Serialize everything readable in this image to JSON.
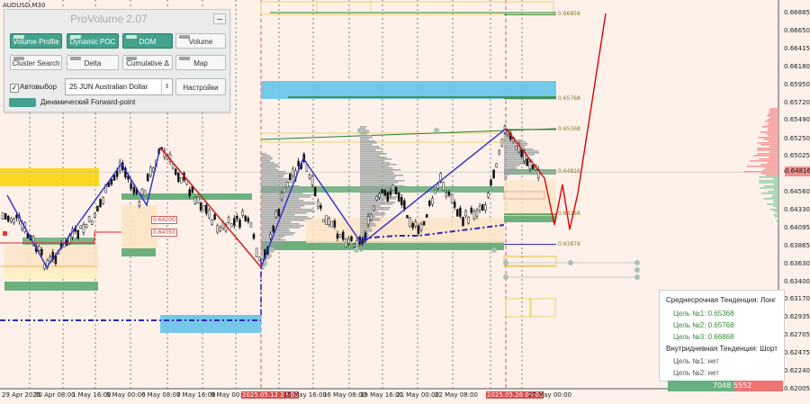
{
  "chart_symbol": "AUDUSD,M30",
  "panel": {
    "title": "ProVolume 2.07",
    "buttons": [
      {
        "label": "Volume Profile",
        "active": true
      },
      {
        "label": "Dynamic POC",
        "active": true
      },
      {
        "label": "DOM",
        "active": true
      },
      {
        "label": "Volume",
        "active": false
      },
      {
        "label": "Cluster Search",
        "active": false
      },
      {
        "label": "Delta",
        "active": false
      },
      {
        "label": "Cumulative Δ",
        "active": false
      },
      {
        "label": "Map",
        "active": false
      }
    ],
    "auto_select_label": "Автовыбор",
    "auto_select_checked": true,
    "instrument": "25 JUN Australian Dollar",
    "settings_label": "Настройки",
    "forward_point_label": "Динамический Forward-point"
  },
  "price_axis": [
    "0.66885",
    "0.66650",
    "0.66415",
    "0.66180",
    "0.65950",
    "0.65720",
    "0.65490",
    "0.65250",
    "0.65025",
    "0.64816",
    "0.64560",
    "0.64330",
    "0.64095",
    "0.63865",
    "0.63630",
    "0.63400",
    "0.63170",
    "0.62935",
    "0.62705",
    "0.62475",
    "0.62240",
    "0.62005"
  ],
  "current_price": "0.64816",
  "level_labels": [
    "0.66858",
    "0.65768",
    "0.65368",
    "0.64816",
    "0.64268",
    "0.63878"
  ],
  "left_labels": [
    "0.64200",
    "0.64050"
  ],
  "time_axis": [
    {
      "label": "29 Apr 2025",
      "hl": false
    },
    {
      "label": "30 Apr 08:00",
      "hl": false
    },
    {
      "label": "1 May 16:00",
      "hl": false
    },
    {
      "label": "5 May 00:00",
      "hl": false
    },
    {
      "label": "6 May 08:00",
      "hl": false
    },
    {
      "label": "7 May 16:00",
      "hl": false
    },
    {
      "label": "9 May 00:00",
      "hl": false
    },
    {
      "label": "2025.05.12 22:00",
      "hl": true
    },
    {
      "label": "15 May 16:00",
      "hl": false
    },
    {
      "label": "16 May 08:00",
      "hl": false
    },
    {
      "label": "19 May 16:00",
      "hl": false
    },
    {
      "label": "21 May 00:00",
      "hl": false
    },
    {
      "label": "22 May 08:00",
      "hl": false
    },
    {
      "label": "2025.05.26 05:00",
      "hl": true
    },
    {
      "label": "27 May 00:00",
      "hl": false
    }
  ],
  "info": {
    "medium_trend": "Среднесрочная Тенденция: Лонг",
    "medium_targets": [
      "Цель №1: 0.65368",
      "Цель №2: 0.65768",
      "Цель №3: 0.66868"
    ],
    "intraday_trend": "Внутридневная Тенденция: Шорт",
    "intraday_targets": [
      "Цель №1: нет",
      "Цель №2: нет"
    ]
  },
  "volume_readout": {
    "buy": "7048",
    "sell": "5552"
  },
  "colors": {
    "background": "#fdf1ea",
    "bull_line": "#2b2bd0",
    "bear_line": "#d11b1b",
    "forecast": "#e00000",
    "zone_green": "#5da872",
    "zone_blue": "#6ec5ea",
    "zone_yellow": "#f7d400",
    "accent_button": "#43a18e"
  },
  "chart_data": {
    "type": "line",
    "title": "",
    "xlabel": "",
    "ylabel": "",
    "ylim": [
      0.62005,
      0.66885
    ],
    "x_ticks": [
      "29 Apr 2025",
      "30 Apr 08:00",
      "1 May 16:00",
      "5 May 00:00",
      "6 May 08:00",
      "7 May 16:00",
      "9 May 00:00",
      "2025.05.12 22:00",
      "15 May 16:00",
      "16 May 08:00",
      "19 May 16:00",
      "21 May 00:00",
      "22 May 08:00",
      "2025.05.26 05:00",
      "27 May 00:00"
    ],
    "series": [
      {
        "values": [
          0.6445,
          0.637,
          0.6502,
          0.6455,
          0.6532,
          0.6365,
          0.6505,
          0.6388,
          0.654,
          0.642
        ]
      },
      {
        "values": [
          0.6532,
          0.636
        ]
      },
      {
        "values": [
          0.654,
          0.6445,
          0.641,
          0.647,
          0.643,
          0.6488,
          0.6412,
          0.6458,
          0.642,
          0.6522,
          0.6605,
          0.67
        ]
      }
    ],
    "levels": [
      0.66858,
      0.65768,
      0.65368,
      0.64816,
      0.64268,
      0.63878
    ]
  }
}
